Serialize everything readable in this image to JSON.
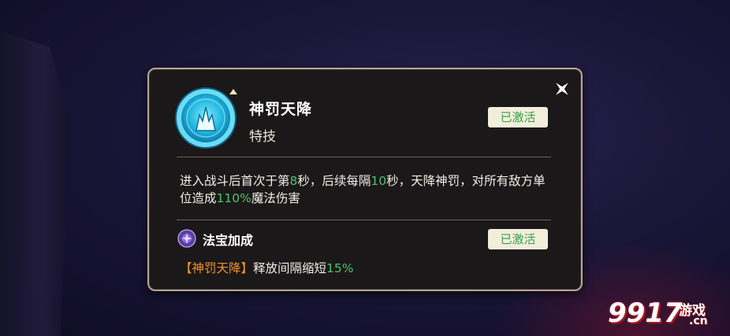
{
  "skill": {
    "name": "神罚天降",
    "type": "特技",
    "status": "已激活",
    "description_parts": {
      "p1": "进入战斗后首次于第",
      "v1": "8",
      "p2": "秒，后续每隔",
      "v2": "10",
      "p3": "秒，天降神罚，对所有敌方单位造成",
      "v3": "110%",
      "p4": "魔法伤害"
    }
  },
  "treasure": {
    "title": "法宝加成",
    "status": "已激活",
    "bonus_skill": "【神罚天降】",
    "bonus_text": "释放间隔缩短",
    "bonus_value": "15%"
  },
  "watermark": {
    "number": "9917",
    "game": "游戏",
    "domain": ".cn"
  },
  "colors": {
    "highlight_green": "#4cc46a",
    "skill_orange": "#f0932a",
    "panel_border": "#b8a596",
    "panel_bg": "#1b1819"
  },
  "icons": {
    "close": "close-x-icon",
    "skill": "lightning-skill-icon",
    "upgrade": "upgrade-arrow-icon",
    "treasure": "treasure-gem-icon"
  }
}
